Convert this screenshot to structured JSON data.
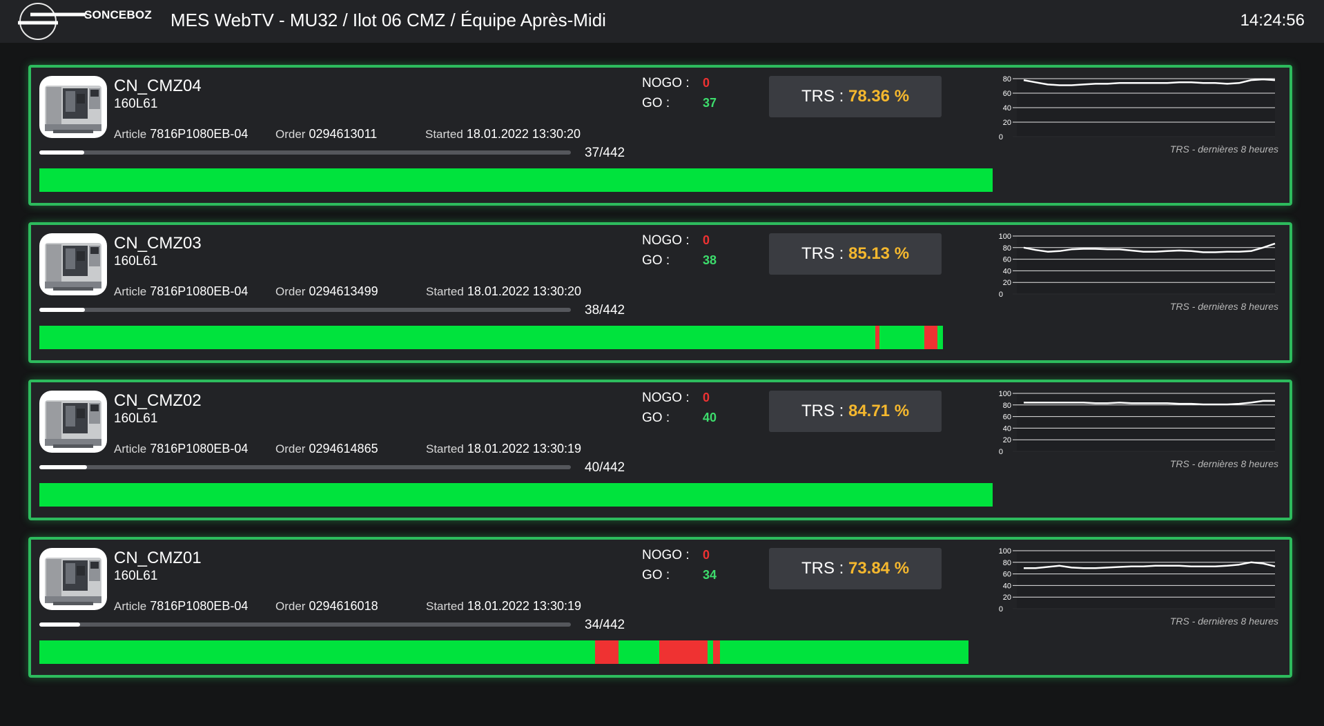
{
  "header": {
    "logo_text": "SONCEBOZ",
    "title": "MES WebTV - MU32 / Ilot 06 CMZ / Équipe Après-Midi",
    "clock": "14:24:56"
  },
  "labels": {
    "nogo": "NOGO :",
    "go": "GO :",
    "trs": "TRS",
    "article": "Article",
    "order": "Order",
    "started": "Started",
    "chart_caption": "TRS - dernières 8 heures"
  },
  "colors": {
    "ok": "#00e33d",
    "fault": "#ef3232",
    "border": "#2dbb5d",
    "trs": "#f5b82e",
    "go": "#3ddc6c",
    "nogo": "#ef3232"
  },
  "machines": [
    {
      "name": "CN_CMZ04",
      "ref": "160L61",
      "article": "7816P1080EB-04",
      "order": "0294613011",
      "started": "18.01.2022 13:30:20",
      "progress_text": "37/442",
      "progress_fraction": 0.084,
      "nogo": "0",
      "go": "37",
      "trs": "78.36 %",
      "chart_data": {
        "type": "line",
        "ylim": [
          0,
          80
        ],
        "yticks": [
          "0",
          "20",
          "40",
          "60",
          "80"
        ],
        "values": [
          78,
          75,
          72,
          71,
          71,
          72,
          73,
          73,
          74,
          74,
          74,
          74,
          74,
          75,
          75,
          74,
          74,
          73,
          74,
          78,
          79,
          78
        ]
      },
      "timeline": [
        {
          "state": "ok",
          "start": 0.0,
          "end": 0.767
        }
      ]
    },
    {
      "name": "CN_CMZ03",
      "ref": "160L61",
      "article": "7816P1080EB-04",
      "order": "0294613499",
      "started": "18.01.2022 13:30:20",
      "progress_text": "38/442",
      "progress_fraction": 0.086,
      "nogo": "0",
      "go": "38",
      "trs": "85.13 %",
      "chart_data": {
        "type": "line",
        "ylim": [
          0,
          100
        ],
        "yticks": [
          "0",
          "20",
          "40",
          "60",
          "80",
          "100"
        ],
        "values": [
          80,
          76,
          73,
          74,
          77,
          78,
          78,
          77,
          77,
          75,
          73,
          73,
          74,
          75,
          74,
          72,
          72,
          73,
          73,
          74,
          80,
          87
        ]
      },
      "timeline": [
        {
          "state": "ok",
          "start": 0.0,
          "end": 0.673
        },
        {
          "state": "fault",
          "start": 0.673,
          "end": 0.676
        },
        {
          "state": "ok",
          "start": 0.676,
          "end": 0.712
        },
        {
          "state": "fault",
          "start": 0.712,
          "end": 0.723
        },
        {
          "state": "ok",
          "start": 0.723,
          "end": 0.727
        }
      ]
    },
    {
      "name": "CN_CMZ02",
      "ref": "160L61",
      "article": "7816P1080EB-04",
      "order": "0294614865",
      "started": "18.01.2022 13:30:19",
      "progress_text": "40/442",
      "progress_fraction": 0.09,
      "nogo": "0",
      "go": "40",
      "trs": "84.71 %",
      "chart_data": {
        "type": "line",
        "ylim": [
          0,
          100
        ],
        "yticks": [
          "0",
          "20",
          "40",
          "60",
          "80",
          "100"
        ],
        "values": [
          84,
          84,
          84,
          84,
          84,
          84,
          83,
          83,
          84,
          83,
          83,
          83,
          83,
          82,
          82,
          81,
          81,
          81,
          82,
          84,
          87,
          87
        ]
      },
      "timeline": [
        {
          "state": "ok",
          "start": 0.0,
          "end": 0.767
        }
      ]
    },
    {
      "name": "CN_CMZ01",
      "ref": "160L61",
      "article": "7816P1080EB-04",
      "order": "0294616018",
      "started": "18.01.2022 13:30:19",
      "progress_text": "34/442",
      "progress_fraction": 0.077,
      "nogo": "0",
      "go": "34",
      "trs": "73.84 %",
      "chart_data": {
        "type": "line",
        "ylim": [
          0,
          100
        ],
        "yticks": [
          "0",
          "20",
          "40",
          "60",
          "80",
          "100"
        ],
        "values": [
          70,
          70,
          72,
          74,
          71,
          70,
          70,
          71,
          72,
          73,
          73,
          74,
          74,
          74,
          73,
          73,
          73,
          74,
          76,
          80,
          78,
          73
        ]
      },
      "timeline": [
        {
          "state": "ok",
          "start": 0.0,
          "end": 0.447
        },
        {
          "state": "fault",
          "start": 0.447,
          "end": 0.466
        },
        {
          "state": "ok",
          "start": 0.466,
          "end": 0.499
        },
        {
          "state": "fault",
          "start": 0.499,
          "end": 0.538
        },
        {
          "state": "ok",
          "start": 0.538,
          "end": 0.542
        },
        {
          "state": "fault",
          "start": 0.542,
          "end": 0.548
        },
        {
          "state": "ok",
          "start": 0.548,
          "end": 0.748
        }
      ]
    }
  ]
}
